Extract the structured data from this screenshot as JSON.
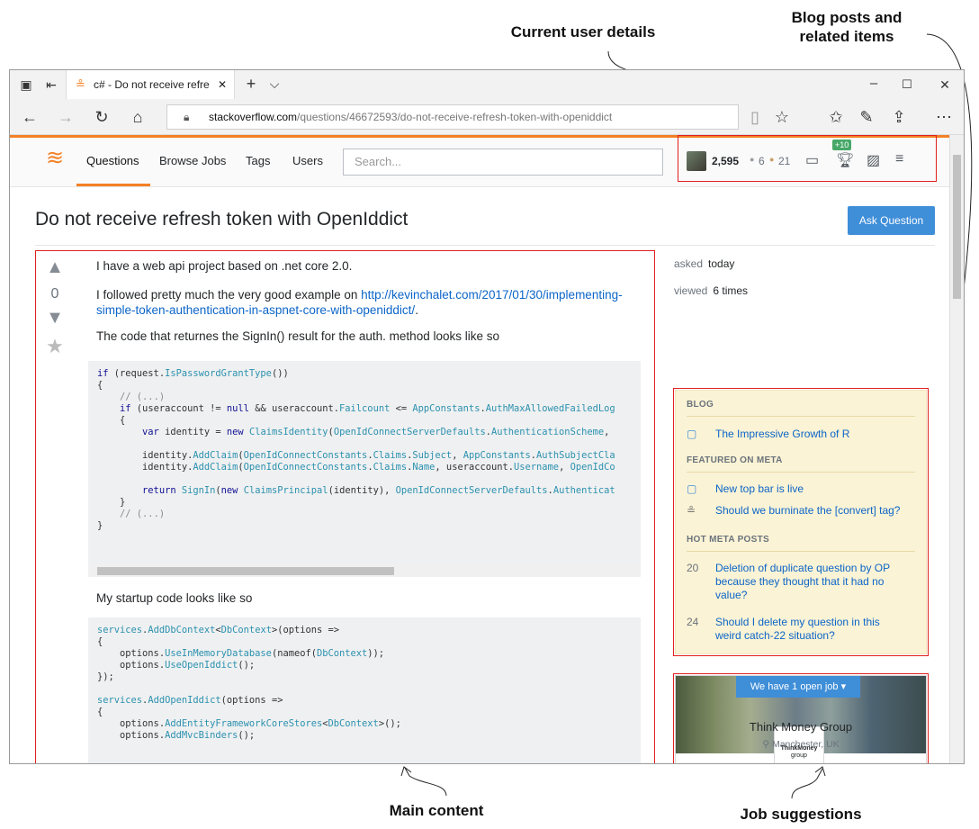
{
  "callouts": {
    "user_details": "Current user details",
    "blog_line1": "Blog posts and",
    "blog_line2": "related items",
    "main_content": "Main content",
    "job_suggestions": "Job suggestions"
  },
  "browser": {
    "tab_title": "c# - Do not receive refre",
    "url_domain": "stackoverflow.com",
    "url_path": "/questions/46672593/do-not-receive-refresh-token-with-openiddict",
    "window_min": "–",
    "window_max": "☐",
    "window_close": "✕",
    "tab_close": "✕",
    "new_tab": "+",
    "tab_dropdown": "⌵"
  },
  "so_header": {
    "nav": [
      "Questions",
      "Browse Jobs",
      "Tags",
      "Users"
    ],
    "search_placeholder": "Search...",
    "reputation": "2,595",
    "silver_badges": "6",
    "bronze_badges": "21",
    "achievements_count": "+10"
  },
  "question": {
    "title": "Do not receive refresh token with OpenIddict",
    "ask_button": "Ask Question",
    "vote_count": "0",
    "para1": "I have a web api project based on .net core 2.0.",
    "para2_prefix": "I followed pretty much the very good example on ",
    "para2_link_1": "http://kevinchalet.com/2017/01/30/implementing-",
    "para2_link_2": "simple-token-authentication-in-aspnet-core-with-openiddict/",
    "para2_suffix": ".",
    "para3": "The code that returnes the SignIn() result for the auth. method looks like so",
    "para4": "My startup code looks like so"
  },
  "sidebar": {
    "asked_label": "asked",
    "asked_value": "today",
    "viewed_label": "viewed",
    "viewed_value": "6 times",
    "blog_heading": "BLOG",
    "blog_item": "The Impressive Growth of R",
    "featured_heading": "FEATURED ON META",
    "featured_items": [
      "New top bar is live",
      "Should we burninate the [convert] tag?"
    ],
    "hot_heading": "HOT META POSTS",
    "hot_items": [
      {
        "num": "20",
        "line1": "Deletion of duplicate question by OP",
        "line2": "because they thought that it had no",
        "line3": "value?"
      },
      {
        "num": "24",
        "line1": "Should I delete my question in this",
        "line2": "weird catch-22 situation?"
      }
    ],
    "job_button": "We have 1 open job ▾",
    "job_logo_text_1": "ThinkMoney",
    "job_logo_text_2": "group",
    "job_company": "Think Money Group",
    "job_location": "Manchester, UK"
  }
}
